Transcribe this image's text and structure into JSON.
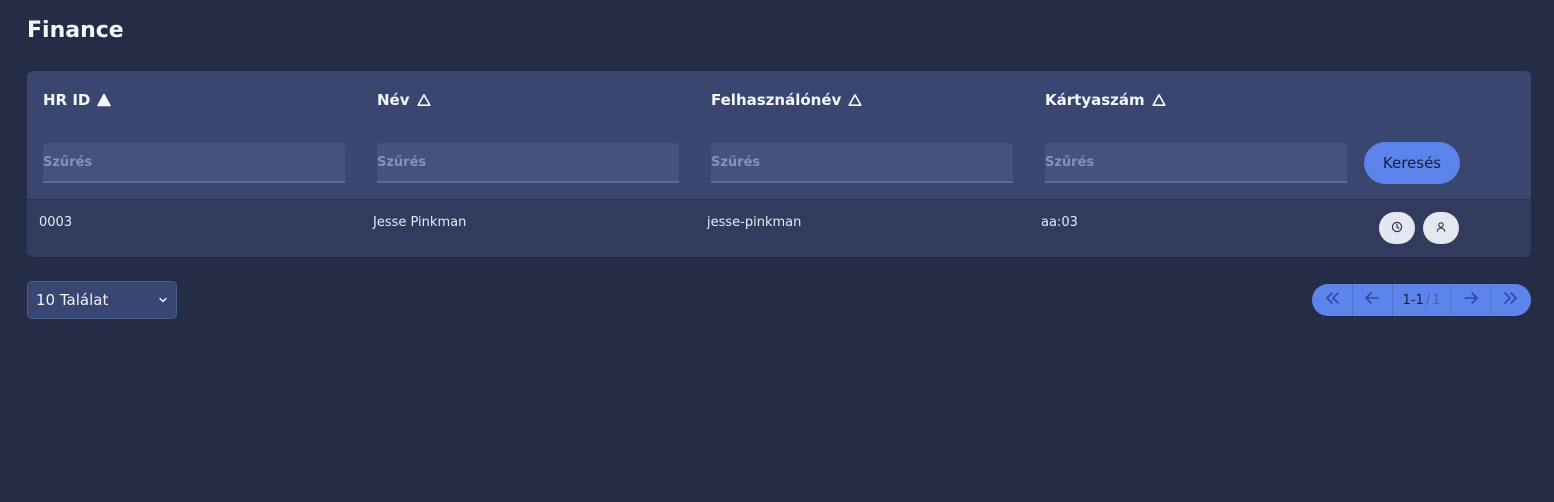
{
  "page": {
    "title": "Finance"
  },
  "table": {
    "columns": [
      {
        "label": "HR ID",
        "sort_icon": "sort-asc-filled-icon",
        "placeholder": "Szűrés"
      },
      {
        "label": "Név",
        "sort_icon": "sort-unsorted-icon",
        "placeholder": "Szűrés"
      },
      {
        "label": "Felhasználónév",
        "sort_icon": "sort-unsorted-icon",
        "placeholder": "Szűrés"
      },
      {
        "label": "Kártyaszám",
        "sort_icon": "sort-unsorted-icon",
        "placeholder": "Szűrés"
      }
    ],
    "search_label": "Keresés",
    "rows": [
      {
        "hr_id": "0003",
        "name": "Jesse Pinkman",
        "username": "jesse-pinkman",
        "card": "aa:03",
        "actions": [
          "clock-icon",
          "user-icon"
        ]
      }
    ]
  },
  "page_size": {
    "selected": "10 Találat"
  },
  "pagination": {
    "current": "1-1",
    "total": "1"
  },
  "colors": {
    "background": "#252c46",
    "card": "#323b5e",
    "header": "#394670",
    "accent": "#5c84ea"
  }
}
